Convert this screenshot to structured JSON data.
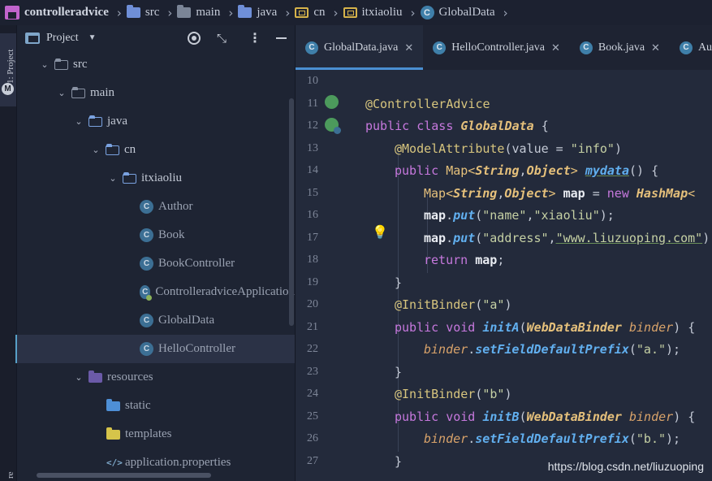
{
  "breadcrumb": {
    "project": "controlleradvice",
    "items": [
      "src",
      "main",
      "java",
      "cn",
      "itxiaoliu",
      "GlobalData"
    ]
  },
  "toolstrip": {
    "project_label": "1: Project",
    "maven_glyph": "M",
    "bottom_label": "re"
  },
  "panel": {
    "title": "Project",
    "dropdown": "▼",
    "collapse_glyph": "⤡",
    "more_glyph": "⋮"
  },
  "tree": [
    {
      "label": "src"
    },
    {
      "label": "main"
    },
    {
      "label": "java"
    },
    {
      "label": "cn"
    },
    {
      "label": "itxiaoliu"
    },
    {
      "label": "Author"
    },
    {
      "label": "Book"
    },
    {
      "label": "BookController"
    },
    {
      "label": "ControlleradviceApplication"
    },
    {
      "label": "GlobalData"
    },
    {
      "label": "HelloController"
    },
    {
      "label": "resources"
    },
    {
      "label": "static"
    },
    {
      "label": "templates"
    },
    {
      "label": "application.properties"
    }
  ],
  "tabs": [
    {
      "label": "GlobalData.java",
      "close": "✕"
    },
    {
      "label": "HelloController.java",
      "close": "✕"
    },
    {
      "label": "Book.java",
      "close": "✕"
    },
    {
      "label": "Aut",
      "close": ""
    }
  ],
  "class_glyph": "C",
  "line_numbers": [
    "10",
    "11",
    "12",
    "13",
    "14",
    "15",
    "16",
    "17",
    "18",
    "19",
    "20",
    "21",
    "22",
    "23",
    "24",
    "25",
    "26",
    "27"
  ],
  "code": {
    "l11": "@ControllerAdvice",
    "l12_kw": "public class ",
    "l12_name": "GlobalData",
    "l12_end": " {",
    "l13_ann": "@ModelAttribute",
    "l13_mid": "(value = ",
    "l13_str": "\"info\"",
    "l13_end": ")",
    "l14_kw": "public ",
    "l14_type": "Map<",
    "l14_t1": "String",
    "l14_c": ",",
    "l14_t2": "Object",
    "l14_gt": "> ",
    "l14_m": "mydata",
    "l14_end": "() {",
    "l15_type": "Map<",
    "l15_t1": "String",
    "l15_c": ",",
    "l15_t2": "Object",
    "l15_gt": "> ",
    "l15_v": "map",
    "l15_eq": " = ",
    "l15_new": "new ",
    "l15_cls": "HashMap",
    "l15_lt": "<",
    "l16_v": "map",
    "l16_dot": ".",
    "l16_m": "put",
    "l16_open": "(",
    "l16_s1": "\"name\"",
    "l16_c": ",",
    "l16_s2": "\"xiaoliu\"",
    "l16_end": ");",
    "l17_v": "map",
    "l17_dot": ".",
    "l17_m": "put",
    "l17_open": "(",
    "l17_s1": "\"address\"",
    "l17_c": ",",
    "l17_s2": "\"www.liuzuoping.com\"",
    "l17_end": ")",
    "l18_kw": "return ",
    "l18_v": "map",
    "l18_end": ";",
    "l19": "}",
    "l20_ann": "@InitBinder",
    "l20_open": "(",
    "l20_str": "\"a\"",
    "l20_end": ")",
    "l21_kw": "public void ",
    "l21_m": "initA",
    "l21_open": "(",
    "l21_type": "WebDataBinder",
    "l21_sp": " ",
    "l21_p": "binder",
    "l21_end": ") {",
    "l22_p": "binder",
    "l22_dot": ".",
    "l22_m": "setFieldDefaultPrefix",
    "l22_open": "(",
    "l22_str": "\"a.\"",
    "l22_end": ");",
    "l23": "}",
    "l24_ann": "@InitBinder",
    "l24_open": "(",
    "l24_str": "\"b\"",
    "l24_end": ")",
    "l25_kw": "public void ",
    "l25_m": "initB",
    "l25_open": "(",
    "l25_type": "WebDataBinder",
    "l25_sp": " ",
    "l25_p": "binder",
    "l25_end": ") {",
    "l26_p": "binder",
    "l26_dot": ".",
    "l26_m": "setFieldDefaultPrefix",
    "l26_open": "(",
    "l26_str": "\"b.\"",
    "l26_end": ");",
    "l27": "}"
  },
  "watermark": "https://blog.csdn.net/liuzuoping",
  "colors": {
    "accent": "#4a8fd2",
    "keyword": "#c678dd",
    "type": "#e5c07b",
    "method": "#61afef"
  }
}
